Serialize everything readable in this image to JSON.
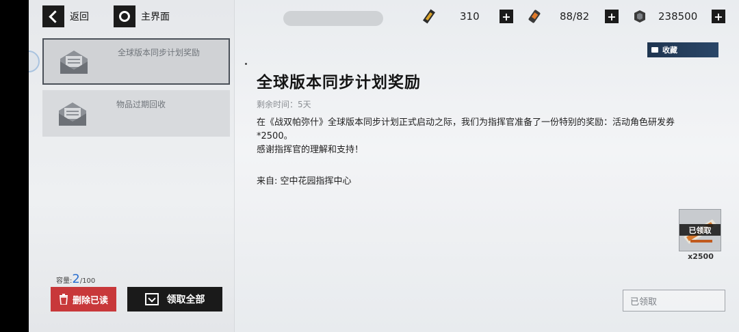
{
  "nav": {
    "back_label": "返回",
    "home_label": "主界面"
  },
  "resources": [
    {
      "icon": "gold-bar-icon",
      "value": "310"
    },
    {
      "icon": "energy-battery-icon",
      "value": "88/82"
    },
    {
      "icon": "coin-icon",
      "value": "238500"
    }
  ],
  "mail_list": [
    {
      "title": "全球版本同步计划奖励",
      "selected": true
    },
    {
      "title": "物品过期回收",
      "selected": false
    }
  ],
  "capacity": {
    "label": "容量:",
    "current": "2",
    "max": "/100"
  },
  "actions": {
    "delete_read": "删除已读",
    "claim_all": "领取全部"
  },
  "favorite_label": "收藏",
  "mail": {
    "title": "全球版本同步计划奖励",
    "remaining": "剩余时间：5天",
    "body_line1": "在《战双帕弥什》全球版本同步计划正式启动之际，我们为指挥官准备了一份特别的奖励：活动角色研发券",
    "body_line2": "*2500。",
    "body_line3": "感谢指挥官的理解和支持！",
    "sender": "来自: 空中花园指挥中心"
  },
  "reward": {
    "status": "已领取",
    "quantity": "x2500"
  },
  "claim_button": "已领取"
}
